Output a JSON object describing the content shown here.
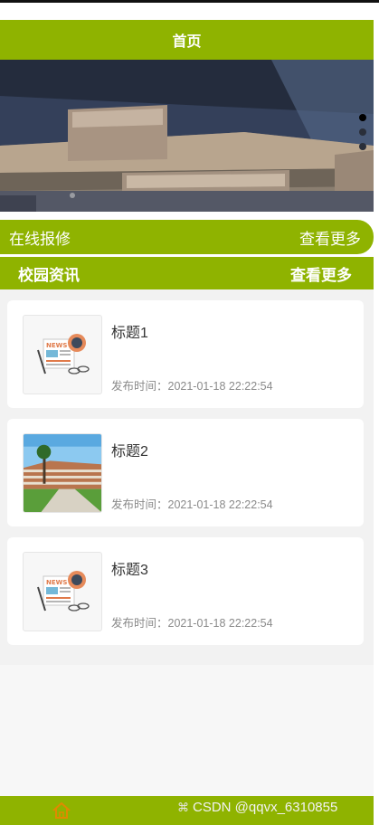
{
  "header": {
    "title": "首页"
  },
  "banner": {
    "dot_count": 3,
    "active_dot": 0
  },
  "repair_bar": {
    "label": "在线报修",
    "more": "查看更多"
  },
  "news_bar": {
    "label": "校园资讯",
    "more": "查看更多"
  },
  "news": [
    {
      "title": "标题1",
      "time": "发布时间：2021-01-18 22:22:54",
      "thumb": "news-icon"
    },
    {
      "title": "标题2",
      "time": "发布时间：2021-01-18 22:22:54",
      "thumb": "campus-photo"
    },
    {
      "title": "标题3",
      "time": "发布时间：2021-01-18 22:22:54",
      "thumb": "news-icon"
    }
  ],
  "tabbar": {
    "home_icon": "home-icon"
  },
  "watermark": {
    "text": "CSDN @qqvx_6310855"
  },
  "colors": {
    "accent": "#8fb300",
    "home_icon": "#e08a00",
    "card_bg": "#ffffff",
    "list_bg": "#f2f2f2"
  }
}
